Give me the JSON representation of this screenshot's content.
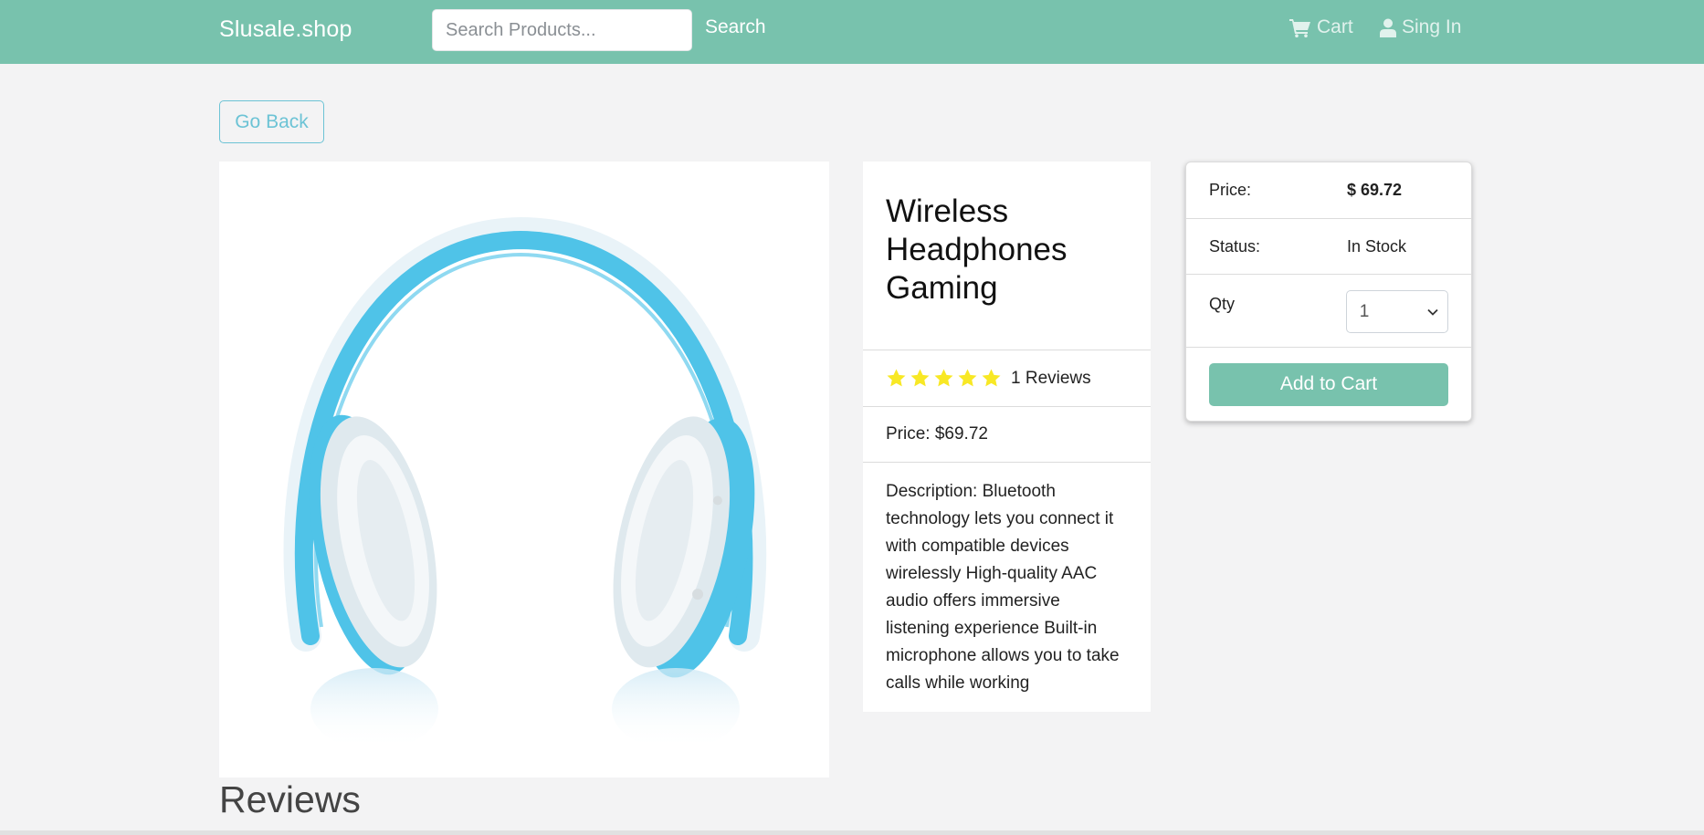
{
  "navbar": {
    "brand": "Slusale.shop",
    "search_placeholder": "Search Products...",
    "search_label": "Search",
    "cart_label": "Cart",
    "signin_label": "Sing In",
    "bg_color": "#78c2ad"
  },
  "go_back_label": "Go Back",
  "product": {
    "title": "Wireless Headphones Gaming",
    "rating": 5,
    "reviews_text": "1 Reviews",
    "price_text": "Price: $69.72",
    "description": "Description: Bluetooth technology lets you connect it with compatible devices wirelessly High-quality AAC audio offers immersive listening experience Built-in microphone allows you to take calls while working"
  },
  "buy_card": {
    "price_label": "Price:",
    "price_value": "$ 69.72",
    "status_label": "Status:",
    "status_value": "In Stock",
    "qty_label": "Qty",
    "qty_value": "1",
    "add_to_cart_label": "Add to Cart"
  },
  "reviews_heading": "Reviews",
  "colors": {
    "accent": "#78c2ad",
    "info": "#6cc3d5",
    "star": "#f8e825",
    "headphone_blue": "#4fc3e8"
  }
}
